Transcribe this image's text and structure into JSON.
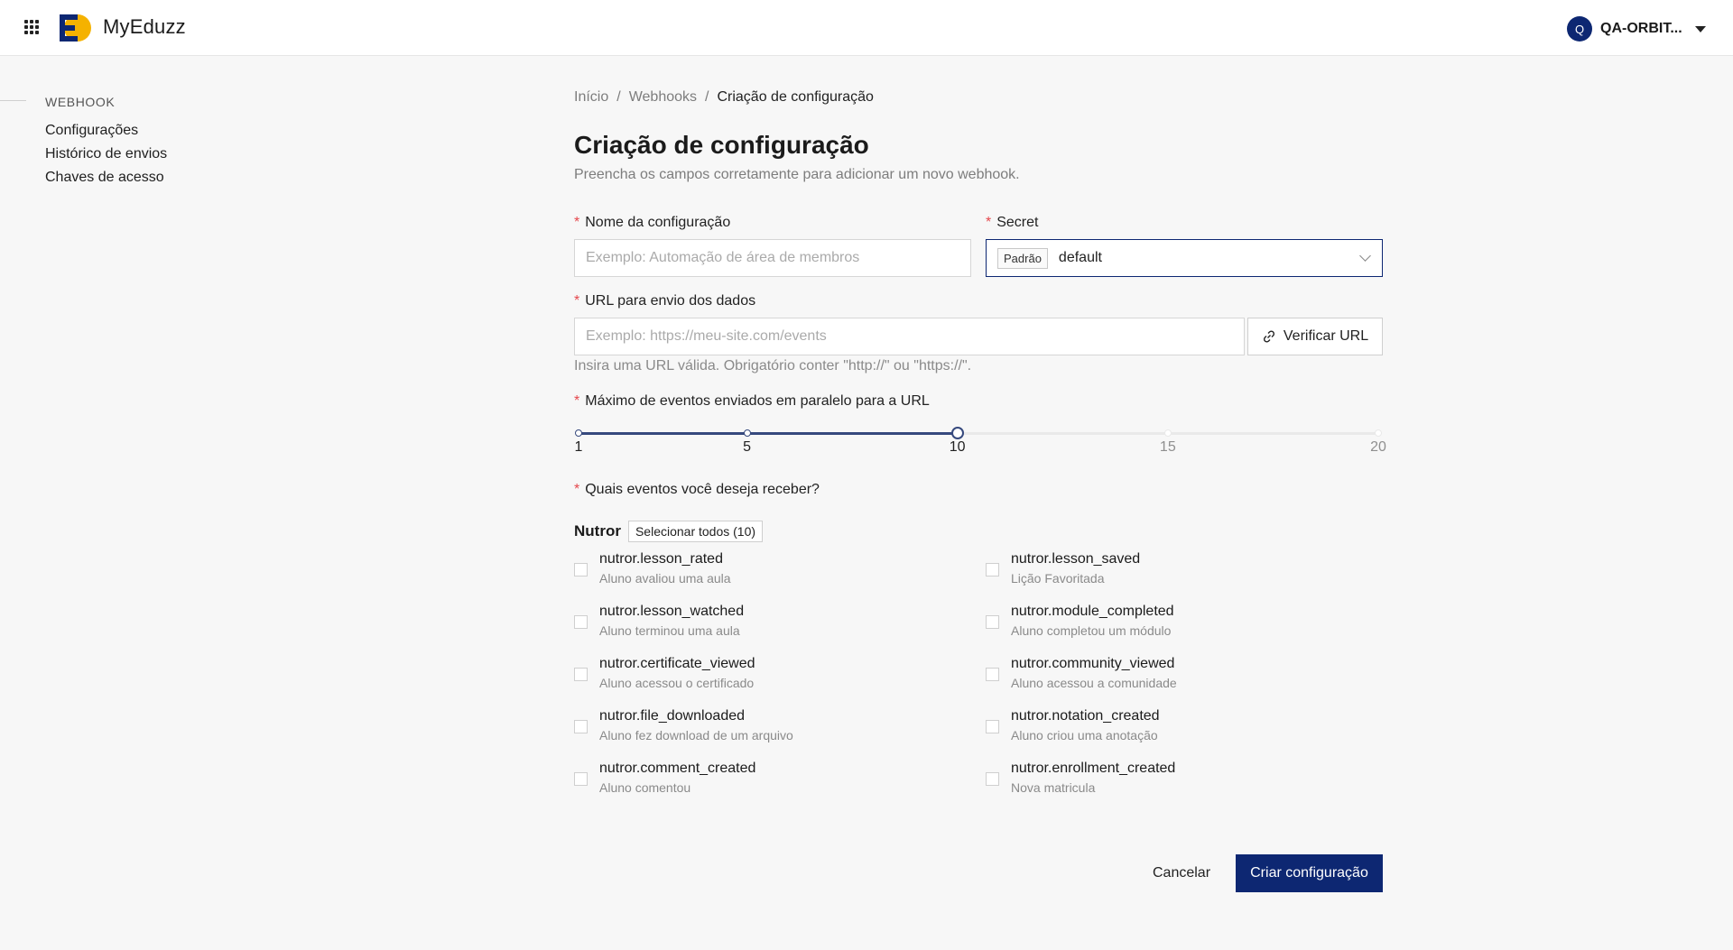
{
  "header": {
    "brand": "MyEduzz",
    "account_initial": "Q",
    "account_name": "QA-ORBIT..."
  },
  "sidebar": {
    "section_title": "WEBHOOK",
    "items": [
      {
        "label": "Configurações"
      },
      {
        "label": "Histórico de envios"
      },
      {
        "label": "Chaves de acesso"
      }
    ]
  },
  "breadcrumb": {
    "items": [
      "Início",
      "Webhooks",
      "Criação de configuração"
    ],
    "separator": "/"
  },
  "page": {
    "title": "Criação de configuração",
    "subtitle": "Preencha os campos corretamente para adicionar um novo webhook."
  },
  "form": {
    "required_mark": "*",
    "name": {
      "label": "Nome da configuração",
      "placeholder": "Exemplo: Automação de área de membros",
      "value": ""
    },
    "secret": {
      "label": "Secret",
      "tag": "Padrão",
      "value": "default"
    },
    "url": {
      "label": "URL para envio dos dados",
      "placeholder": "Exemplo: https://meu-site.com/events",
      "value": "",
      "verify_label": "Verificar URL",
      "hint": "Insira uma URL válida. Obrigatório conter \"http://\" ou \"https://\"."
    },
    "parallel": {
      "label": "Máximo de eventos enviados em paralelo para a URL",
      "min": 1,
      "max": 20,
      "value": 10,
      "marks": [
        "1",
        "5",
        "10",
        "15",
        "20"
      ]
    },
    "events": {
      "label": "Quais eventos você deseja receber?",
      "group_name": "Nutror",
      "select_all_label": "Selecionar todos (10)",
      "items": [
        {
          "name": "nutror.lesson_rated",
          "desc": "Aluno avaliou uma aula",
          "checked": false
        },
        {
          "name": "nutror.lesson_saved",
          "desc": "Lição Favoritada",
          "checked": false
        },
        {
          "name": "nutror.lesson_watched",
          "desc": "Aluno terminou uma aula",
          "checked": false
        },
        {
          "name": "nutror.module_completed",
          "desc": "Aluno completou um módulo",
          "checked": false
        },
        {
          "name": "nutror.certificate_viewed",
          "desc": "Aluno acessou o certificado",
          "checked": false
        },
        {
          "name": "nutror.community_viewed",
          "desc": "Aluno acessou a comunidade",
          "checked": false
        },
        {
          "name": "nutror.file_downloaded",
          "desc": "Aluno fez download de um arquivo",
          "checked": false
        },
        {
          "name": "nutror.notation_created",
          "desc": "Aluno criou uma anotação",
          "checked": false
        },
        {
          "name": "nutror.comment_created",
          "desc": "Aluno comentou",
          "checked": false
        },
        {
          "name": "nutror.enrollment_created",
          "desc": "Nova matricula",
          "checked": false
        }
      ]
    }
  },
  "actions": {
    "cancel_label": "Cancelar",
    "submit_label": "Criar configuração"
  },
  "colors": {
    "primary": "#0d2772",
    "required": "#e5484d",
    "logo_yellow": "#f5b200"
  },
  "icons": {
    "apps": "apps-grid-icon",
    "link": "link-icon",
    "caret": "caret-down-icon",
    "chevron": "chevron-down-icon"
  }
}
